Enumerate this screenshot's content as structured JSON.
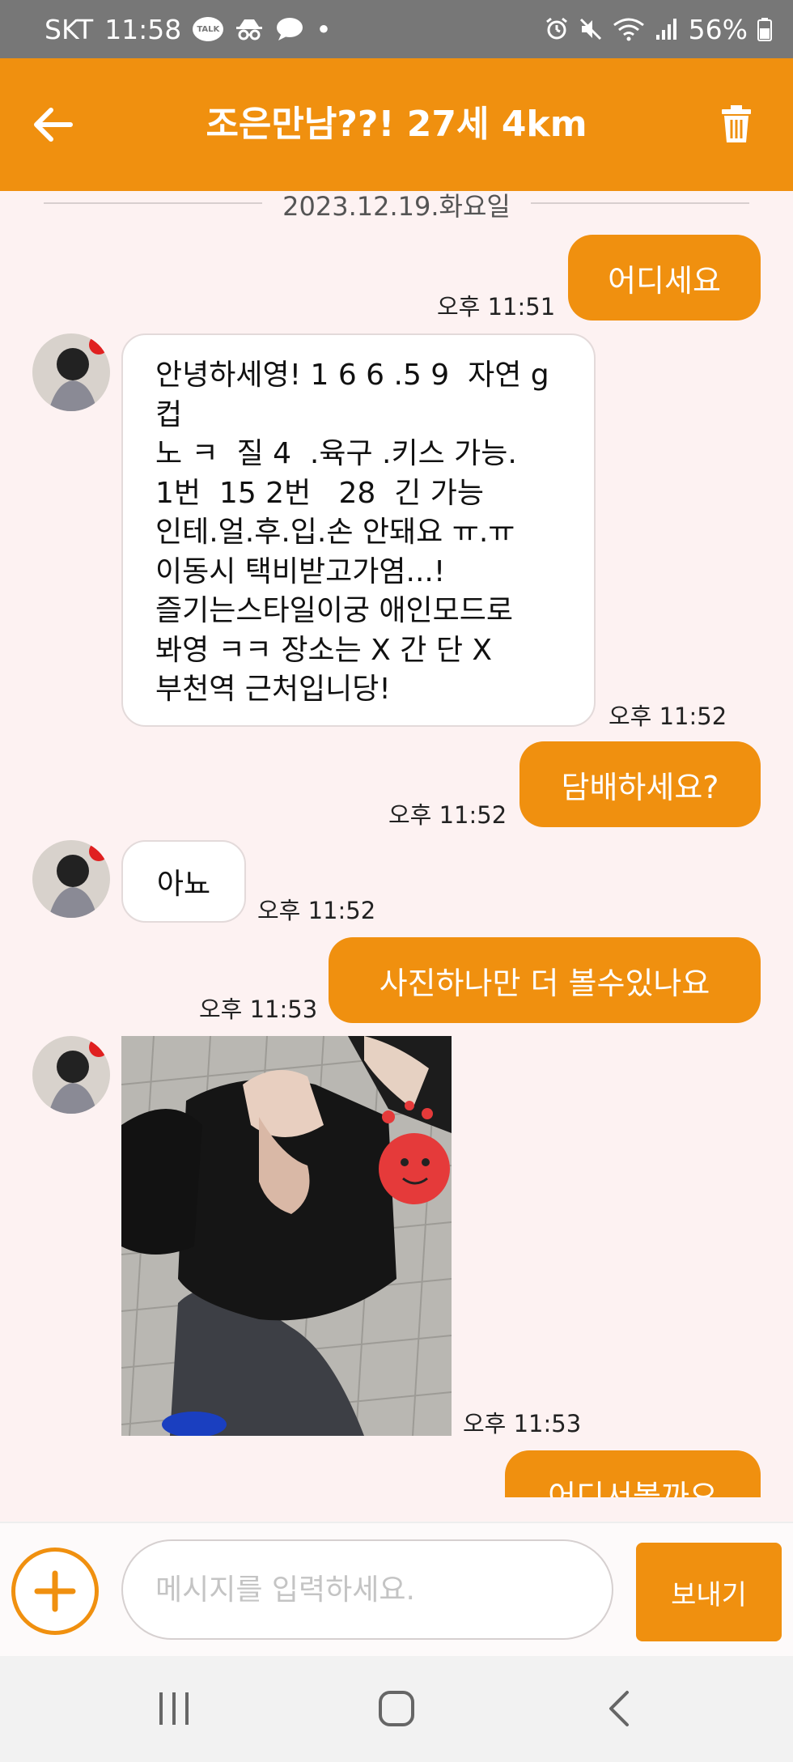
{
  "status_bar": {
    "carrier": "SKT",
    "time": "11:58",
    "talk_badge": "TALK",
    "dot": "•",
    "battery": "56%",
    "icons": [
      "talk-icon",
      "incognito-icon",
      "chat-icon",
      "alarm-icon",
      "mute-icon",
      "wifi-icon",
      "signal-icon",
      "battery-icon"
    ]
  },
  "header": {
    "title": "조은만남??! 27세 4km",
    "back_icon": "arrow-left-icon",
    "delete_icon": "trash-icon"
  },
  "chat": {
    "date": "2023.12.19.화요일",
    "messages": [
      {
        "direction": "out",
        "text": "어디세요",
        "time": "오후 11:51"
      },
      {
        "direction": "in",
        "lines": [
          "안녕하세영! 1 6 6 .5 9  자연 g",
          "컵",
          "노 ㅋ  질 4  .육구 .키스 가능.",
          "1번  15 2번   28  긴 가능",
          "인테.얼.후.입.손 안돼요 ㅠ.ㅠ",
          "이동시 택비받고가염...!",
          "즐기는스타일이궁 애인모드로",
          "봐영 ㅋㅋ 장소는 X 간 단 X",
          "부천역 근처입니당!"
        ],
        "time": "오후 11:52"
      },
      {
        "direction": "out",
        "text": "담배하세요?",
        "time": "오후 11:52"
      },
      {
        "direction": "in",
        "text": "아뇨",
        "time": "오후 11:52"
      },
      {
        "direction": "out",
        "text": "사진하나만 더 볼수있나요",
        "time": "오후 11:53"
      },
      {
        "direction": "in",
        "type": "photo",
        "time": "오후 11:53"
      },
      {
        "direction": "out",
        "text": "어디서볼까요"
      }
    ]
  },
  "input_bar": {
    "placeholder": "메시지를 입력하세요.",
    "value": "",
    "send_label": "보내기",
    "add_icon": "plus-icon"
  },
  "nav_bar": {
    "icons": [
      "recents-icon",
      "home-icon",
      "back-icon"
    ]
  },
  "colors": {
    "accent": "#f0900f",
    "chat_background": "#fdf2f2",
    "status_bar": "#777777"
  }
}
